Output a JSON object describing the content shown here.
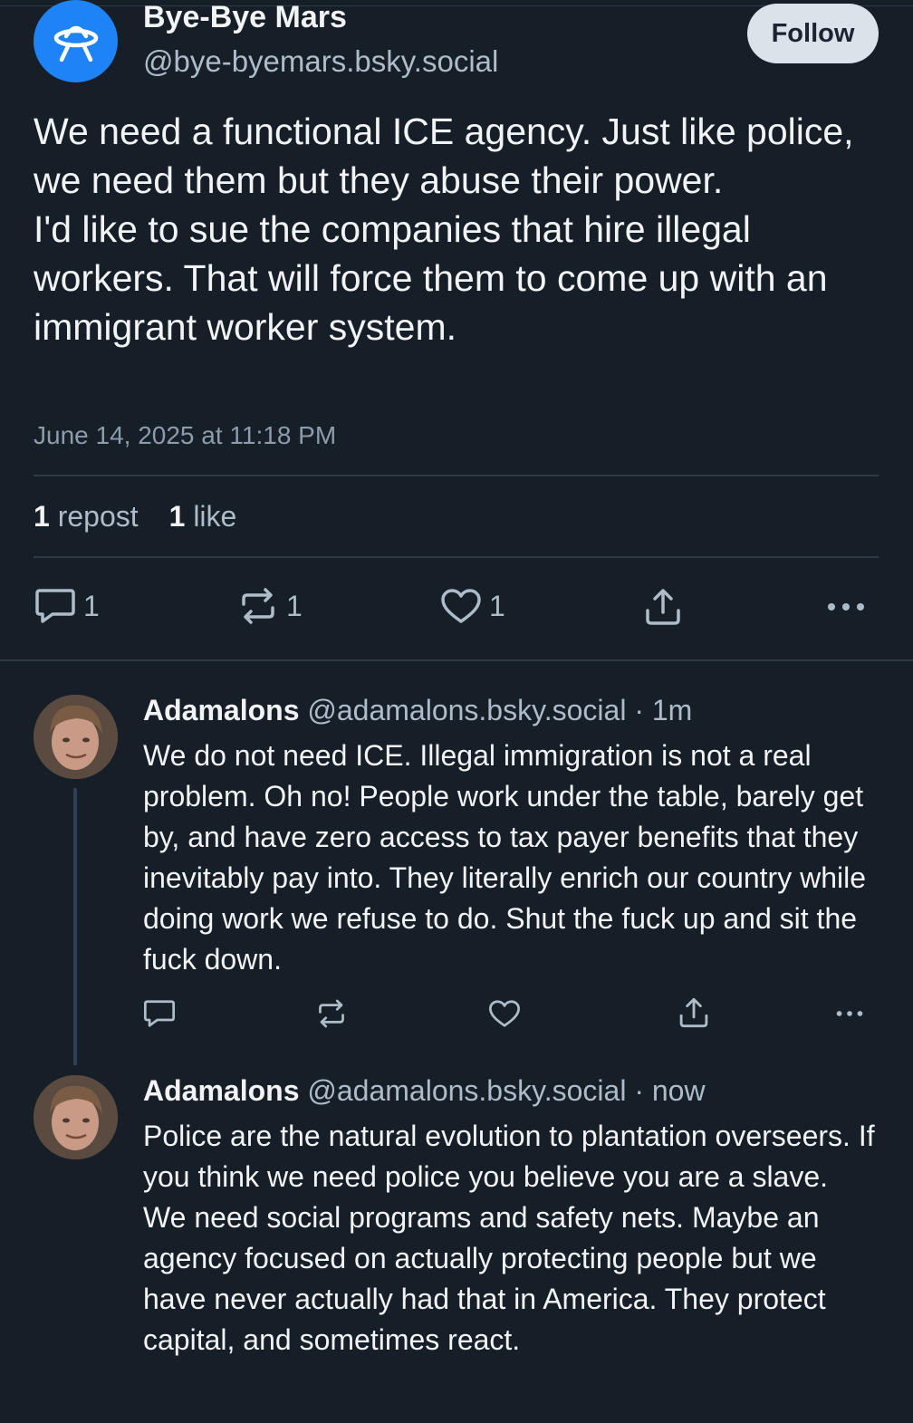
{
  "main_post": {
    "author_name": "Bye-Bye Mars",
    "author_handle": "@bye-byemars.bsky.social",
    "follow_label": "Follow",
    "text_lines": [
      "We need a functional ICE agency. Just like police, we need them but they abuse their power.",
      "I'd like to sue the companies that hire illegal workers. That will force them to come up with an immigrant worker system."
    ],
    "timestamp": "June 14, 2025 at 11:18 PM",
    "stats": {
      "repost_count": "1",
      "repost_label": "repost",
      "like_count": "1",
      "like_label": "like"
    },
    "actions": {
      "reply_count": "1",
      "repost_count": "1",
      "like_count": "1"
    }
  },
  "replies": [
    {
      "author_name": "Adamalons",
      "author_handle": "@adamalons.bsky.social",
      "separator": "·",
      "time": "1m",
      "text": "We do not need ICE. Illegal immigration is not a real problem. Oh no! People work under the table, barely get by, and have zero access to tax payer benefits that they inevitably pay into. They literally enrich our country while doing work we refuse to do. Shut the fuck up and sit the fuck down."
    },
    {
      "author_name": "Adamalons",
      "author_handle": "@adamalons.bsky.social",
      "separator": "·",
      "time": "now",
      "text": "Police are the natural evolution to plantation overseers. If you think we need police you believe you are a slave. We need social programs and safety nets. Maybe an agency focused on actually protecting people but we have never actually had that in America. They protect capital, and sometimes react."
    }
  ],
  "colors": {
    "background": "#161e27",
    "avatar_blue": "#1e83f7",
    "secondary_text": "#aebbc9",
    "divider": "#2c3947"
  }
}
